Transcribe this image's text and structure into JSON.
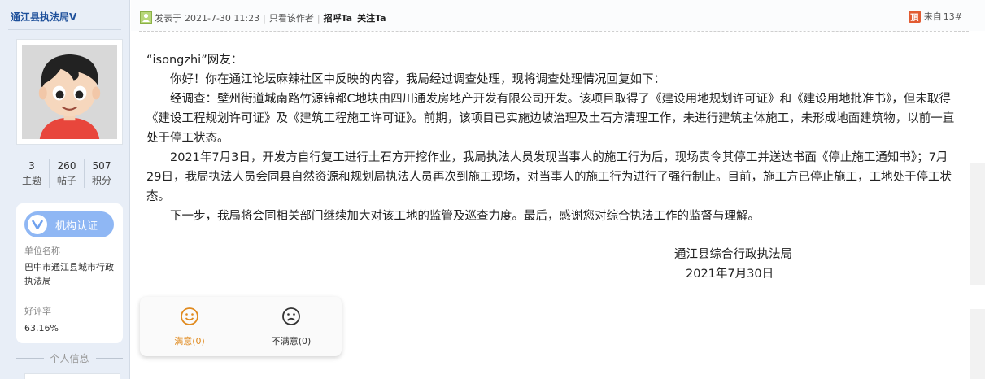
{
  "author": {
    "name": "通江县执法局",
    "badge": "V",
    "stats": [
      {
        "value": "3",
        "label": "主题"
      },
      {
        "value": "260",
        "label": "帖子"
      },
      {
        "value": "507",
        "label": "积分"
      }
    ],
    "certification": {
      "badge_label": "机构认证",
      "unit_label": "单位名称",
      "unit_value": "巴中市通江县城市行政执法局",
      "rating_label": "好评率",
      "rating_value": "63.16%"
    },
    "personal_info_label": "个人信息"
  },
  "post": {
    "posted_prefix": "发表于",
    "posted_time": "2021-7-30 11:23",
    "only_author": "只看该作者",
    "greet": "招呼Ta",
    "follow": "关注Ta",
    "from_icon": "頂",
    "from_label": "来自",
    "floor": "13#",
    "body": [
      "“isongzhi”网友：",
      "　　你好！你在通江论坛麻辣社区中反映的内容，我局经过调查处理，现将调查处理情况回复如下：",
      "　　经调查：壁州街道城南路竹源锦都C地块由四川通发房地产开发有限公司开发。该项目取得了《建设用地规划许可证》和《建设用地批准书》，但未取得《建设工程规划许可证》及《建筑工程施工许可证》。前期，该项目已实施边坡治理及土石方清理工作，未进行建筑主体施工，未形成地面建筑物，以前一直处于停工状态。",
      "　　2021年7月3日，开发方自行复工进行土石方开挖作业，我局执法人员发现当事人的施工行为后，现场责令其停工并送达书面《停止施工通知书》；7月29日，我局执法人员会同县自然资源和规划局执法人员再次到施工现场，对当事人的施工行为进行了强行制止。目前，施工方已停止施工，工地处于停工状态。",
      "　　下一步，我局将会同相关部门继续加大对该工地的监管及巡查力度。最后，感谢您对综合执法工作的监督与理解。"
    ],
    "signature_org": "通江县综合行政执法局",
    "signature_date": "2021年7月30日"
  },
  "rating": {
    "satisfied": "满意(0)",
    "unsatisfied": "不满意(0)"
  },
  "colors": {
    "username": "#1d4f9a",
    "badge_bg": "#8fb7f4",
    "satisfied": "#e08a1e"
  }
}
